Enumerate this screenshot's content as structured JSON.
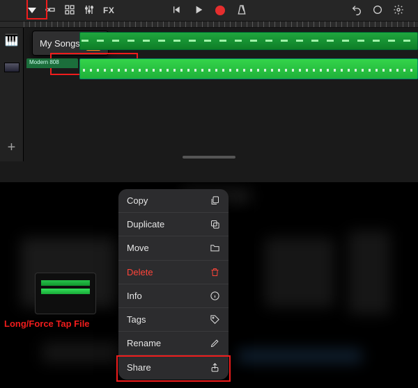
{
  "colors": {
    "highlight": "#f01c1c",
    "record": "#e52e2e",
    "region": "#1fb13a"
  },
  "toolbar": {
    "fx_label": "FX",
    "icons": {
      "menu": "menu-caret",
      "trackview": "track-view",
      "grid": "grid-view",
      "mixer": "mixers",
      "rewind": "go-to-beginning",
      "play": "play",
      "record": "record",
      "metronome": "metronome",
      "undo": "undo",
      "loop": "loop-browser",
      "settings": "settings"
    }
  },
  "popup": {
    "title": "My Songs"
  },
  "tracks": {
    "t1": {
      "instrument_icon": "🎹"
    },
    "t2": {
      "label": "Modern 808"
    }
  },
  "annotation": {
    "tap": "Long/Force Tap File"
  },
  "context_menu": {
    "items": [
      {
        "label": "Copy",
        "icon": "copy-icon"
      },
      {
        "label": "Duplicate",
        "icon": "duplicate-icon"
      },
      {
        "label": "Move",
        "icon": "folder-icon"
      },
      {
        "label": "Delete",
        "icon": "trash-icon",
        "destructive": true
      },
      {
        "label": "Info",
        "icon": "info-icon"
      },
      {
        "label": "Tags",
        "icon": "tag-icon"
      },
      {
        "label": "Rename",
        "icon": "pencil-icon"
      },
      {
        "label": "Share",
        "icon": "share-icon"
      }
    ]
  }
}
